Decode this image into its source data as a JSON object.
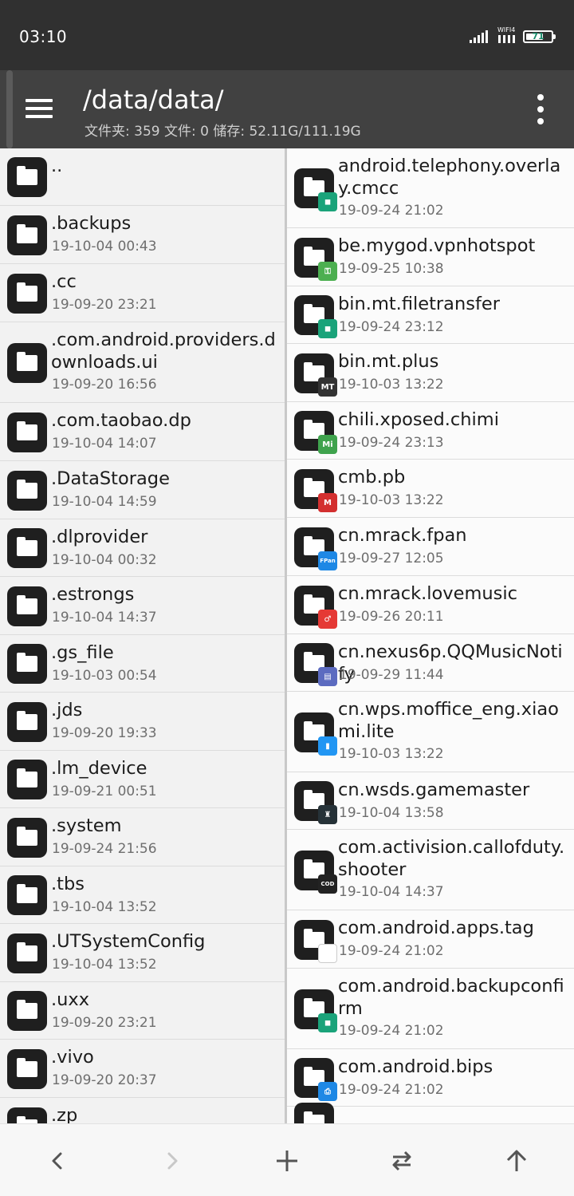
{
  "status_bar": {
    "time": "03:10",
    "wifi_label": "WIFI4",
    "battery_percent": "71",
    "battery_level": 0.71
  },
  "app_bar": {
    "path": "/data/data/",
    "stats": "文件夹: 359  文件: 0  储存: 52.11G/111.19G"
  },
  "left_panel": [
    {
      "name": "..",
      "date": ""
    },
    {
      "name": ".backups",
      "date": "19-10-04 00:43"
    },
    {
      "name": ".cc",
      "date": "19-09-20 23:21"
    },
    {
      "name": ".com.android.providers.downloads.ui",
      "date": "19-09-20 16:56"
    },
    {
      "name": ".com.taobao.dp",
      "date": "19-10-04 14:07"
    },
    {
      "name": ".DataStorage",
      "date": "19-10-04 14:59"
    },
    {
      "name": ".dlprovider",
      "date": "19-10-04 00:32"
    },
    {
      "name": ".estrongs",
      "date": "19-10-04 14:37"
    },
    {
      "name": ".gs_file",
      "date": "19-10-03 00:54"
    },
    {
      "name": ".jds",
      "date": "19-09-20 19:33"
    },
    {
      "name": ".lm_device",
      "date": "19-09-21 00:51"
    },
    {
      "name": ".system",
      "date": "19-09-24 21:56"
    },
    {
      "name": ".tbs",
      "date": "19-10-04 13:52"
    },
    {
      "name": ".UTSystemConfig",
      "date": "19-10-04 13:52"
    },
    {
      "name": ".uxx",
      "date": "19-09-20 23:21"
    },
    {
      "name": ".vivo",
      "date": "19-09-20 20:37"
    },
    {
      "name": ".zp",
      "date": ""
    }
  ],
  "right_panel": [
    {
      "name": "android.telephony.overlay.cmcc",
      "date": "19-09-24 21:02",
      "badge_icon": "android-icon",
      "badge_color": "#1aa37a",
      "badge_text": ""
    },
    {
      "name": "be.mygod.vpnhotspot",
      "date": "19-09-25 10:38",
      "badge_icon": "key-icon",
      "badge_color": "#4caf50",
      "badge_text": ""
    },
    {
      "name": "bin.mt.filetransfer",
      "date": "19-09-24 23:12",
      "badge_icon": "android-icon",
      "badge_color": "#1aa37a",
      "badge_text": ""
    },
    {
      "name": "bin.mt.plus",
      "date": "19-10-03 13:22",
      "badge_icon": "mt-icon",
      "badge_color": "#333333",
      "badge_text": "MT"
    },
    {
      "name": "chili.xposed.chimi",
      "date": "19-09-24 23:13",
      "badge_icon": "mi-icon",
      "badge_color": "#3fa34d",
      "badge_text": "Mi"
    },
    {
      "name": "cmb.pb",
      "date": "19-10-03 13:22",
      "badge_icon": "cmb-icon",
      "badge_color": "#d32f2f",
      "badge_text": "M"
    },
    {
      "name": "cn.mrack.fpan",
      "date": "19-09-27 12:05",
      "badge_icon": "fpan-icon",
      "badge_color": "#1e88e5",
      "badge_text": "FPan"
    },
    {
      "name": "cn.mrack.lovemusic",
      "date": "19-09-26 20:11",
      "badge_icon": "music-icon",
      "badge_color": "#e53935",
      "badge_text": "♂"
    },
    {
      "name": "cn.nexus6p.QQMusicNotify",
      "date": "19-09-29 11:44",
      "badge_icon": "notify-icon",
      "badge_color": "#5c6bc0",
      "badge_text": "▤"
    },
    {
      "name": "cn.wps.moffice_eng.xiaomi.lite",
      "date": "19-10-03 13:22",
      "badge_icon": "document-icon",
      "badge_color": "#2196f3",
      "badge_text": "▮"
    },
    {
      "name": "cn.wsds.gamemaster",
      "date": "19-10-04 13:58",
      "badge_icon": "rocket-icon",
      "badge_color": "#263238",
      "badge_text": "♜"
    },
    {
      "name": "com.activision.callofduty.shooter",
      "date": "19-10-04 14:37",
      "badge_icon": "callofduty-icon",
      "badge_color": "#222222",
      "badge_text": "COD"
    },
    {
      "name": "com.android.apps.tag",
      "date": "19-09-24 21:02",
      "badge_icon": "nfc-tag-icon",
      "badge_color": "#ffffff",
      "badge_text": ""
    },
    {
      "name": "com.android.backupconfirm",
      "date": "19-09-24 21:02",
      "badge_icon": "android-icon",
      "badge_color": "#1aa37a",
      "badge_text": ""
    },
    {
      "name": "com.android.bips",
      "date": "19-09-24 21:02",
      "badge_icon": "print-icon",
      "badge_color": "#1e88e5",
      "badge_text": "⎙"
    },
    {
      "name": "",
      "date": "",
      "badge_icon": "android-icon",
      "badge_color": "#1aa37a",
      "badge_text": ""
    }
  ],
  "bottom_bar": {
    "back_icon": "chevron-left-icon",
    "forward_icon": "chevron-right-icon",
    "add_icon": "plus-icon",
    "swap_icon": "swap-arrows-icon",
    "up_icon": "arrow-up-icon"
  },
  "colors": {
    "status_bar_bg": "#303030",
    "app_bar_bg": "#414141",
    "folder_icon_bg": "#1f1f1f",
    "date_text": "#6e6e6e"
  }
}
